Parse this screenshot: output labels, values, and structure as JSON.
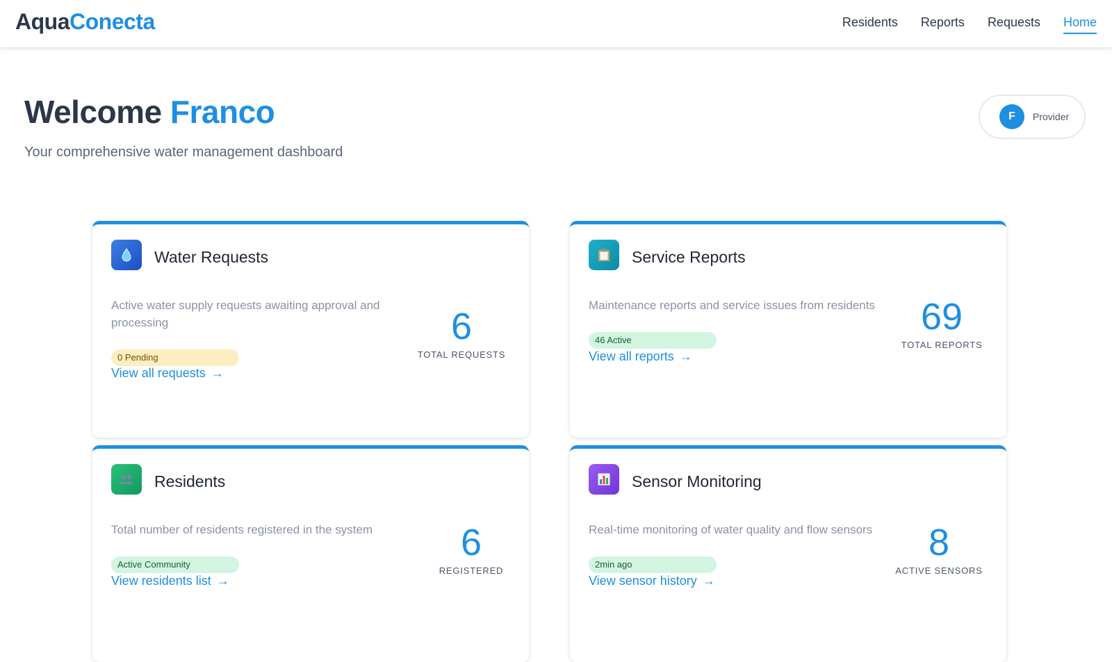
{
  "brand": {
    "part1": "Aqua",
    "part2": "Conecta"
  },
  "nav": {
    "residents": "Residents",
    "reports": "Reports",
    "requests": "Requests",
    "home": "Home"
  },
  "header": {
    "welcome": "Welcome",
    "name": "Franco",
    "subtitle": "Your comprehensive water management dashboard"
  },
  "user": {
    "initial": "F",
    "role": "Provider"
  },
  "cards": {
    "water_requests": {
      "icon": "droplet-icon",
      "title": "Water Requests",
      "description": "Active water supply requests awaiting approval and processing",
      "badge": "0 Pending",
      "link": "View all requests",
      "count": "6",
      "count_label": "TOTAL REQUESTS"
    },
    "service_reports": {
      "icon": "clipboard-icon",
      "title": "Service Reports",
      "description": "Maintenance reports and service issues from residents",
      "badge": "46 Active",
      "link": "View all reports",
      "count": "69",
      "count_label": "TOTAL REPORTS"
    },
    "residents": {
      "icon": "people-icon",
      "title": "Residents",
      "description": "Total number of residents registered in the system",
      "badge": "Active Community",
      "link": "View residents list",
      "count": "6",
      "count_label": "REGISTERED"
    },
    "sensors": {
      "icon": "bar-chart-icon",
      "title": "Sensor Monitoring",
      "description": "Real-time monitoring of water quality and flow sensors",
      "badge": "2min ago",
      "link": "View sensor history",
      "count": "8",
      "count_label": "ACTIVE SENSORS"
    }
  },
  "colors": {
    "accent": "#1e8fe1",
    "text_dark": "#2d3748",
    "badge_yellow": "#fdeec2",
    "badge_green": "#d2f5e2"
  }
}
